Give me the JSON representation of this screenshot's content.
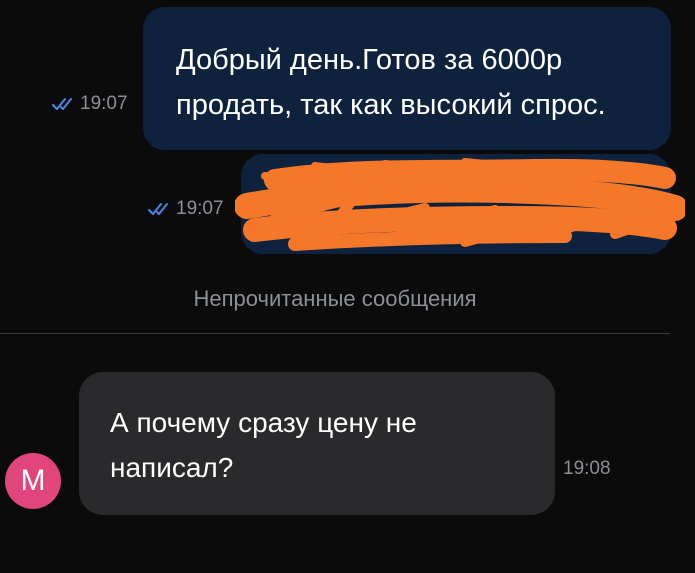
{
  "messages": [
    {
      "direction": "outgoing",
      "text": "Добрый день.Готов за 6000р\nпродать, так как высокий спрос.",
      "time": "19:07",
      "status_icon": "double-check-icon",
      "redacted": false
    },
    {
      "direction": "outgoing",
      "text": "",
      "time": "19:07",
      "status_icon": "double-check-icon",
      "redacted": true
    },
    {
      "direction": "incoming",
      "sender_initial": "M",
      "text": "А почему сразу цену не\nнаписал?",
      "time": "19:08"
    }
  ],
  "unread_divider": {
    "label": "Непрочитанные сообщения"
  },
  "colors": {
    "background": "#0b0b0c",
    "outgoing_bubble": "#0f223d",
    "incoming_bubble": "#2a2a2c",
    "avatar": "#e0457b",
    "check": "#4a88e8",
    "redaction": "#f5782a",
    "muted_text": "#8b8f96"
  }
}
